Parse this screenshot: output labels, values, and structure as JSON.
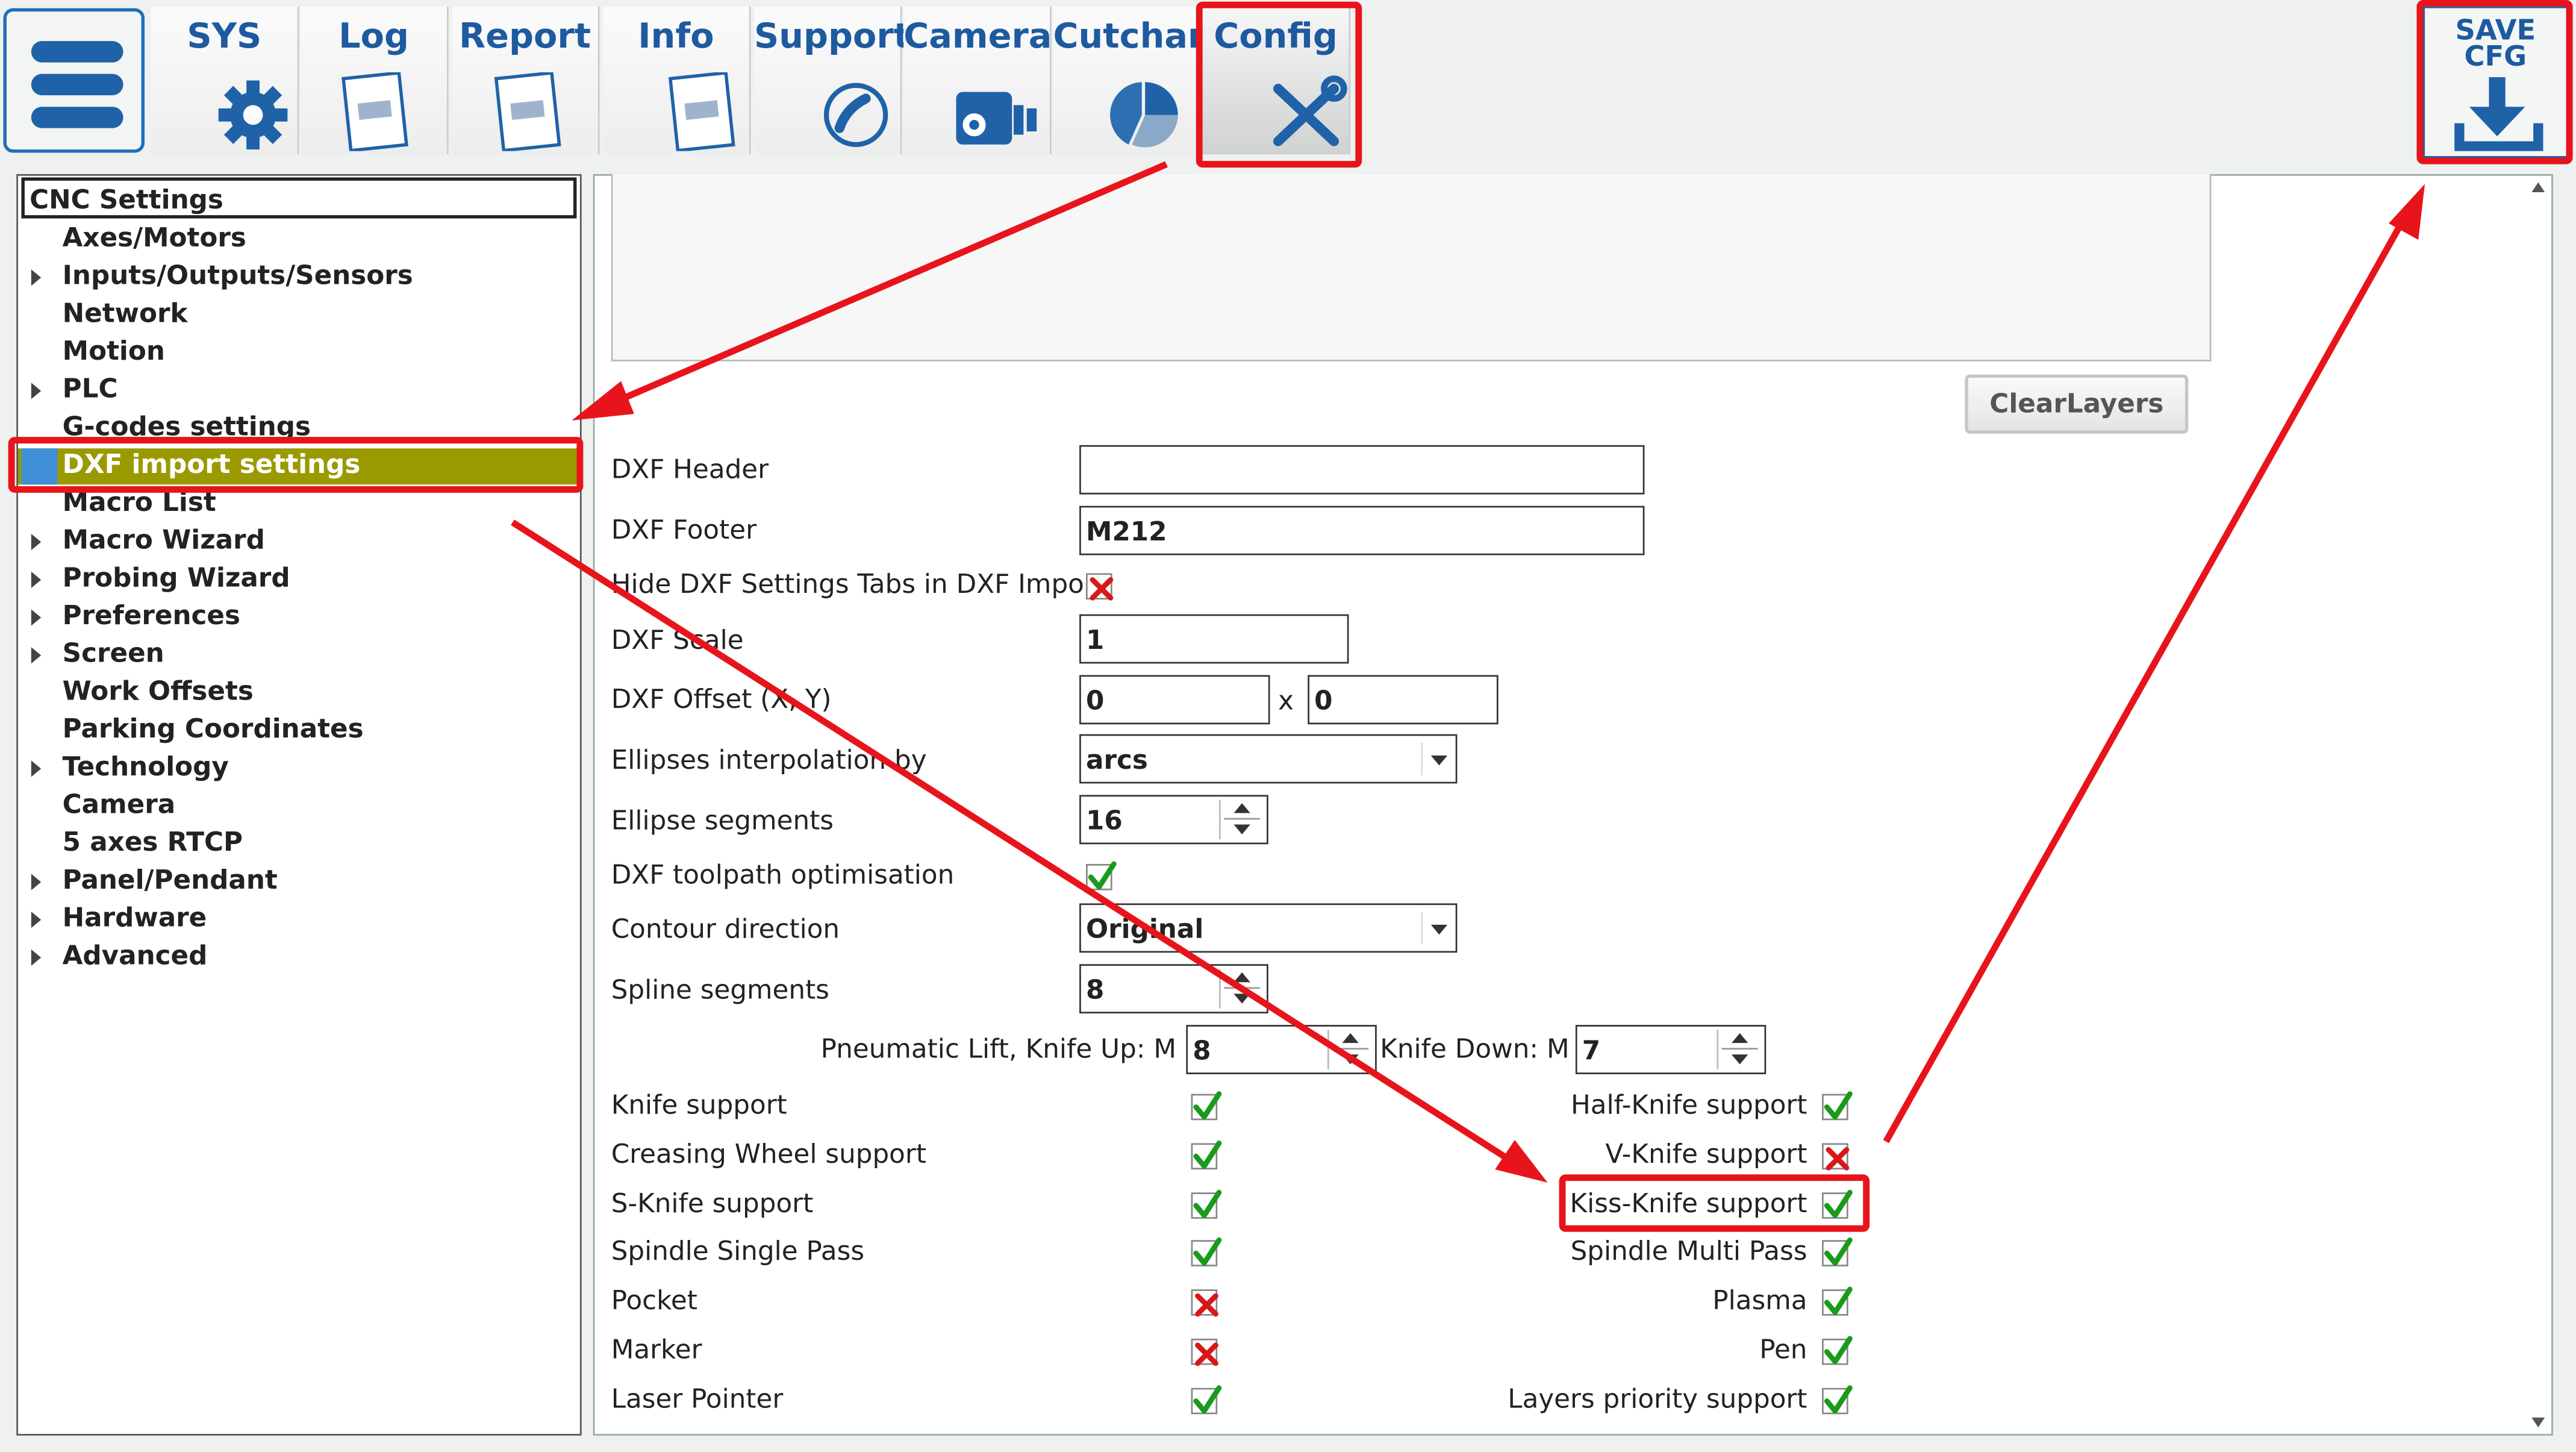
{
  "toolbar": {
    "tabs": [
      {
        "label": "SYS",
        "icon": "gear-icon"
      },
      {
        "label": "Log",
        "icon": "log-sheet-icon"
      },
      {
        "label": "Report",
        "icon": "report-sheet-icon"
      },
      {
        "label": "Info",
        "icon": "info-sheet-icon"
      },
      {
        "label": "Support",
        "icon": "phone-icon"
      },
      {
        "label": "Camera",
        "icon": "camera-icon"
      },
      {
        "label": "Cutchart",
        "icon": "pie-chart-icon"
      },
      {
        "label": "Config",
        "icon": "tools-icon"
      }
    ],
    "active_tab": "Config",
    "save": {
      "line1": "SAVE",
      "line2": "CFG",
      "icon": "download-icon"
    }
  },
  "tree": {
    "header": "CNC Settings",
    "items": [
      {
        "label": "Axes/Motors",
        "expandable": false
      },
      {
        "label": "Inputs/Outputs/Sensors",
        "expandable": true
      },
      {
        "label": "Network",
        "expandable": false
      },
      {
        "label": "Motion",
        "expandable": false
      },
      {
        "label": "PLC",
        "expandable": true
      },
      {
        "label": "G-codes settings",
        "expandable": false
      },
      {
        "label": "DXF import settings",
        "expandable": false,
        "selected": true
      },
      {
        "label": "Macro List",
        "expandable": false
      },
      {
        "label": "Macro Wizard",
        "expandable": true
      },
      {
        "label": "Probing Wizard",
        "expandable": true
      },
      {
        "label": "Preferences",
        "expandable": true
      },
      {
        "label": "Screen",
        "expandable": true
      },
      {
        "label": "Work Offsets",
        "expandable": false
      },
      {
        "label": "Parking Coordinates",
        "expandable": false
      },
      {
        "label": "Technology",
        "expandable": true
      },
      {
        "label": "Camera",
        "expandable": false
      },
      {
        "label": "5 axes RTCP",
        "expandable": false
      },
      {
        "label": "Panel/Pendant",
        "expandable": true
      },
      {
        "label": "Hardware",
        "expandable": true
      },
      {
        "label": "Advanced",
        "expandable": true
      }
    ]
  },
  "content": {
    "clear_layers": "ClearLayers",
    "dxf_header": {
      "label": "DXF Header",
      "value": ""
    },
    "dxf_footer": {
      "label": "DXF Footer",
      "value": "M212"
    },
    "hide_tabs": {
      "label": "Hide DXF Settings Tabs in DXF Import",
      "checked": false
    },
    "dxf_scale": {
      "label": "DXF Scale",
      "value": "1"
    },
    "dxf_offset": {
      "label": "DXF Offset (X, Y)",
      "x": "0",
      "sep": "x",
      "y": "0"
    },
    "ellipses_interp": {
      "label": "Ellipses interpolation by",
      "value": "arcs"
    },
    "ellipse_segments": {
      "label": "Ellipse segments",
      "value": "16"
    },
    "toolpath_opt": {
      "label": "DXF toolpath optimisation",
      "checked": true
    },
    "contour_direction": {
      "label": "Contour direction",
      "value": "Original"
    },
    "spline_segments": {
      "label": "Spline segments",
      "value": "8"
    },
    "knife_up": {
      "label": "Pneumatic Lift, Knife Up: M",
      "value": "8"
    },
    "knife_down": {
      "label": "Knife Down: M",
      "value": "7"
    },
    "left_checks": [
      {
        "label": "Knife support",
        "checked": true
      },
      {
        "label": "Creasing Wheel support",
        "checked": true
      },
      {
        "label": "S-Knife support",
        "checked": true
      },
      {
        "label": "Spindle Single Pass",
        "checked": true
      },
      {
        "label": "Pocket",
        "checked": false
      },
      {
        "label": "Marker",
        "checked": false
      },
      {
        "label": "Laser Pointer",
        "checked": true
      }
    ],
    "right_checks": [
      {
        "label": "Half-Knife support",
        "checked": true
      },
      {
        "label": "V-Knife support",
        "checked": false
      },
      {
        "label": "Kiss-Knife support",
        "checked": true
      },
      {
        "label": "Spindle Multi Pass",
        "checked": true
      },
      {
        "label": "Plasma",
        "checked": true
      },
      {
        "label": "Pen",
        "checked": true
      },
      {
        "label": "Layers priority support",
        "checked": true
      }
    ]
  },
  "colors": {
    "accent": "#1d5aa0",
    "selection": "#9a9a00",
    "annotation": "#e8141b",
    "check_on": "#1a9a1a",
    "check_off": "#d81818"
  }
}
